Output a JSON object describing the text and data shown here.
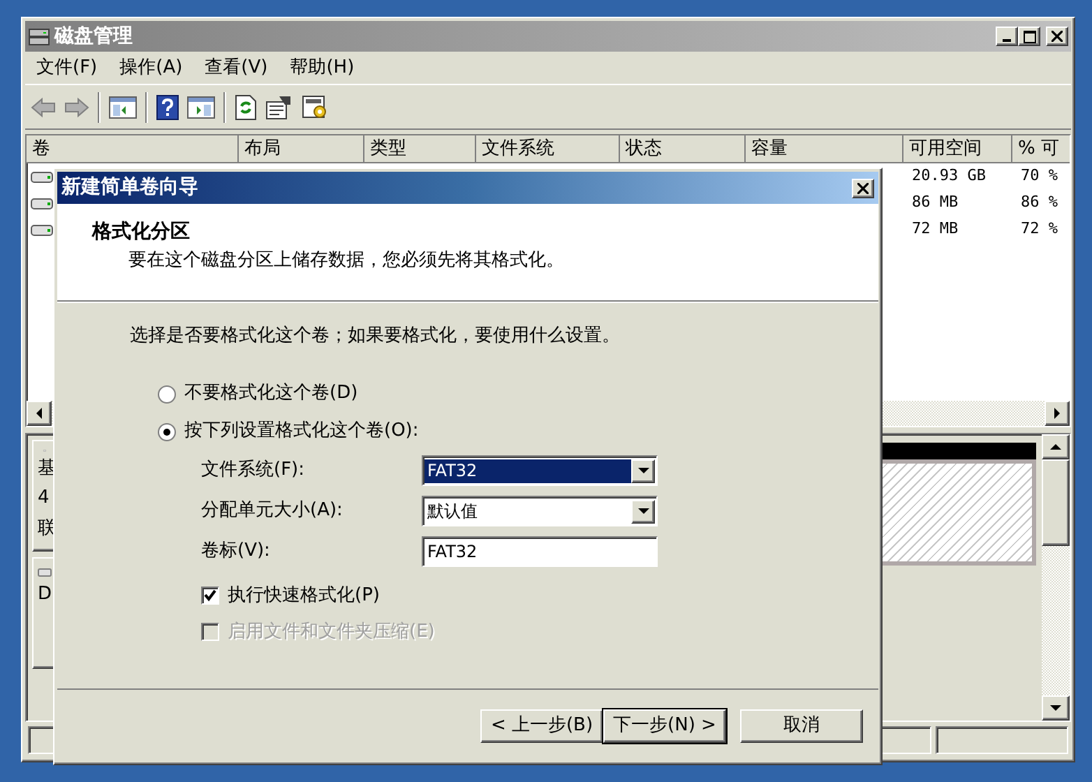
{
  "window": {
    "title": "磁盘管理"
  },
  "menu": [
    {
      "label": "文件(F)"
    },
    {
      "label": "操作(A)"
    },
    {
      "label": "查看(V)"
    },
    {
      "label": "帮助(H)"
    }
  ],
  "volume_list": {
    "columns": [
      "卷",
      "布局",
      "类型",
      "文件系统",
      "状态",
      "容量",
      "可用空间",
      "% 可"
    ],
    "rows": [
      {
        "available": "20.93 GB",
        "percent": "70 %"
      },
      {
        "available": "86 MB",
        "percent": "86 %"
      },
      {
        "available": "72 MB",
        "percent": "72 %"
      }
    ]
  },
  "disk_pane": {
    "disks": [
      {
        "lines": [
          "基",
          "4",
          "联"
        ]
      },
      {
        "lines": [
          "D"
        ]
      }
    ]
  },
  "dialog": {
    "title": "新建简单卷向导",
    "heading": "格式化分区",
    "subheading": "要在这个磁盘分区上储存数据，您必须先将其格式化。",
    "prompt": "选择是否要格式化这个卷；如果要格式化，要使用什么设置。",
    "options": [
      {
        "label": "不要格式化这个卷(D)",
        "selected": false
      },
      {
        "label": "按下列设置格式化这个卷(O):",
        "selected": true
      }
    ],
    "fields": [
      {
        "kind": "select",
        "label": "文件系统(F):",
        "value": "FAT32",
        "highlighted": true
      },
      {
        "kind": "select",
        "label": "分配单元大小(A):",
        "value": "默认值",
        "highlighted": false
      },
      {
        "kind": "text",
        "label": "卷标(V):",
        "value": "FAT32",
        "highlighted": false
      }
    ],
    "checkboxes": [
      {
        "label": "执行快速格式化(P)",
        "checked": true,
        "disabled": false
      },
      {
        "label": "启用文件和文件夹压缩(E)",
        "checked": false,
        "disabled": true
      }
    ],
    "buttons": [
      {
        "label": "< 上一步(B)",
        "default": false
      },
      {
        "label": "下一步(N) >",
        "default": true
      },
      {
        "label": "取消",
        "default": false
      }
    ]
  }
}
